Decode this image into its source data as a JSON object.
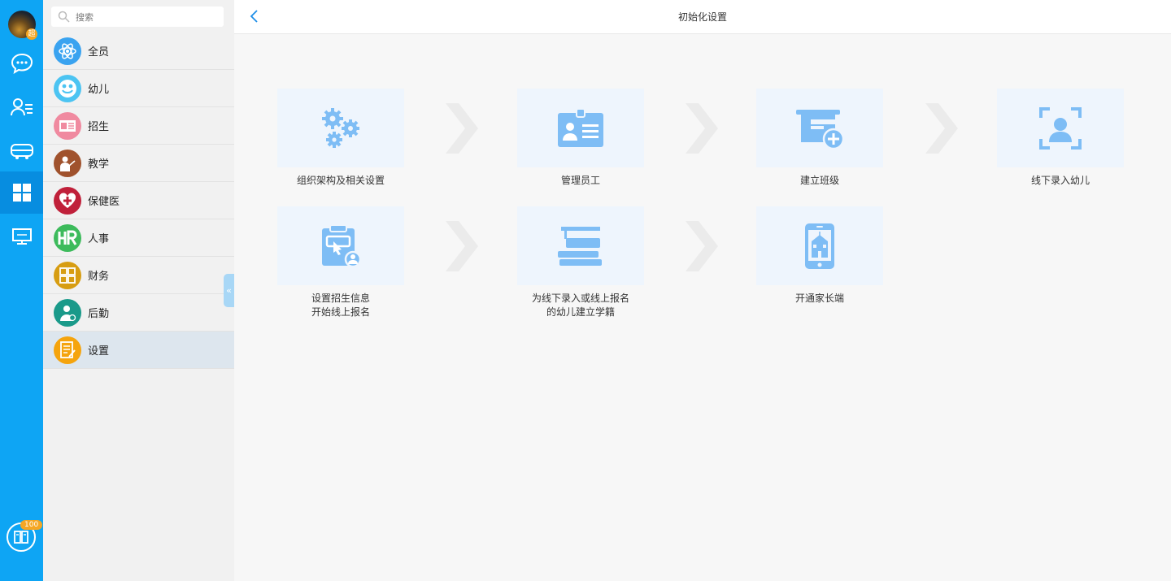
{
  "rail": {
    "avatar_badge": "超",
    "items": [
      {
        "icon": "chat-bubble-icon"
      },
      {
        "icon": "user-list-icon"
      },
      {
        "icon": "bus-icon"
      },
      {
        "icon": "grid-icon"
      },
      {
        "icon": "monitor-icon"
      }
    ],
    "active_index": 3,
    "bottom_badge": "100",
    "bottom_icon": "book-icon"
  },
  "sidebar": {
    "search_placeholder": "搜索",
    "items": [
      {
        "label": "全员",
        "icon": "atom-icon",
        "color": "#3aa3f0"
      },
      {
        "label": "幼儿",
        "icon": "smiley-icon",
        "color": "#4cc4f2"
      },
      {
        "label": "招生",
        "icon": "id-card-icon",
        "color": "#f08aa0"
      },
      {
        "label": "教学",
        "icon": "teacher-icon",
        "color": "#a0522d"
      },
      {
        "label": "保健医",
        "icon": "heart-cross-icon",
        "color": "#c0203a"
      },
      {
        "label": "人事",
        "icon": "hr-icon",
        "color": "#3dbb5c"
      },
      {
        "label": "财务",
        "icon": "finance-icon",
        "color": "#d79d12"
      },
      {
        "label": "后勤",
        "icon": "logistics-icon",
        "color": "#1a9a8a"
      },
      {
        "label": "设置",
        "icon": "settings-doc-icon",
        "color": "#f5a40d"
      }
    ],
    "selected_index": 8
  },
  "header": {
    "title": "初始化设置"
  },
  "steps": [
    {
      "label": "组织架构及相关设置",
      "icon": "gears-icon"
    },
    {
      "label": "管理员工",
      "icon": "badge-icon"
    },
    {
      "label": "建立班级",
      "icon": "classroom-add-icon"
    },
    {
      "label": "线下录入幼儿",
      "icon": "scan-person-icon"
    },
    {
      "label": "设置招生信息",
      "label2": "开始线上报名",
      "icon": "clipboard-icon"
    },
    {
      "label": "为线下录入或线上报名",
      "label2": "的幼儿建立学籍",
      "icon": "books-icon"
    },
    {
      "label": "开通家长端",
      "icon": "phone-school-icon"
    }
  ],
  "colors": {
    "rail": "#0ea5f4",
    "icon_blue": "#7ebdf5",
    "card_bg": "#eef5fd"
  }
}
